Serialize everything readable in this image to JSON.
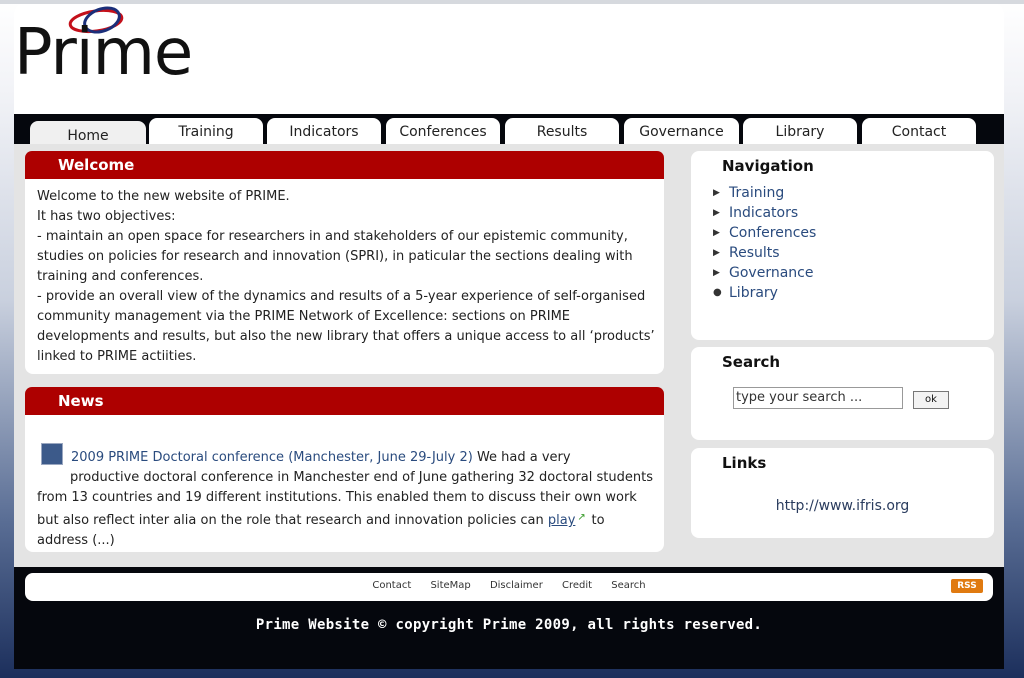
{
  "brand": {
    "logo_text": "Prime"
  },
  "tabs": [
    {
      "label": "Home"
    },
    {
      "label": "Training"
    },
    {
      "label": "Indicators"
    },
    {
      "label": "Conferences"
    },
    {
      "label": "Results"
    },
    {
      "label": "Governance"
    },
    {
      "label": "Library"
    },
    {
      "label": "Contact"
    }
  ],
  "welcome": {
    "title": "Welcome",
    "lines": [
      "Welcome to the new website of PRIME.",
      "It has two objectives:",
      "- maintain an open space for researchers in and stakeholders of our epistemic community,",
      "studies on policies for research and innovation (SPRI), in paticular the sections dealing with",
      "training and conferences.",
      "- provide an overall view of the dynamics and results of a 5-year experience of self-organised",
      "community management via the PRIME Network of Excellence: sections on PRIME",
      "developments and results, but also the new library that offers a unique access to all ‘products’",
      "linked to PRIME actiities."
    ]
  },
  "news": {
    "title": "News",
    "item_title": "2009 PRIME Doctoral conference (Manchester, June 29-July 2)",
    "text_1": " We had a very",
    "line_2": "productive doctoral conference in Manchester end of June gathering 32 doctoral students",
    "line_3": "from 13 countries and 19 different institutions. This enabled them to discuss their own work",
    "line_4_start": "but also reflect inter alia on the role that research and innovation policies can ",
    "play_link": "play",
    "line_4_end": " to",
    "line_5": "address (...)"
  },
  "navigation": {
    "title": "Navigation",
    "items": [
      {
        "label": "Training"
      },
      {
        "label": "Indicators"
      },
      {
        "label": "Conferences"
      },
      {
        "label": "Results"
      },
      {
        "label": "Governance"
      },
      {
        "label": "Library"
      }
    ]
  },
  "search": {
    "title": "Search",
    "placeholder": "type your search ...",
    "button": "ok"
  },
  "links": {
    "title": "Links",
    "url": "http://www.ifris.org"
  },
  "footer": {
    "links": [
      "Contact",
      "SiteMap",
      "Disclaimer",
      "Credit",
      "Search"
    ],
    "rss": "RSS",
    "copyright": "Prime Website © copyright Prime 2009, all rights reserved."
  },
  "colors": {
    "accent_red": "#ad0000",
    "link_blue": "#2a4b7e",
    "frame_black": "#05070d",
    "rss_orange": "#e07a10"
  }
}
